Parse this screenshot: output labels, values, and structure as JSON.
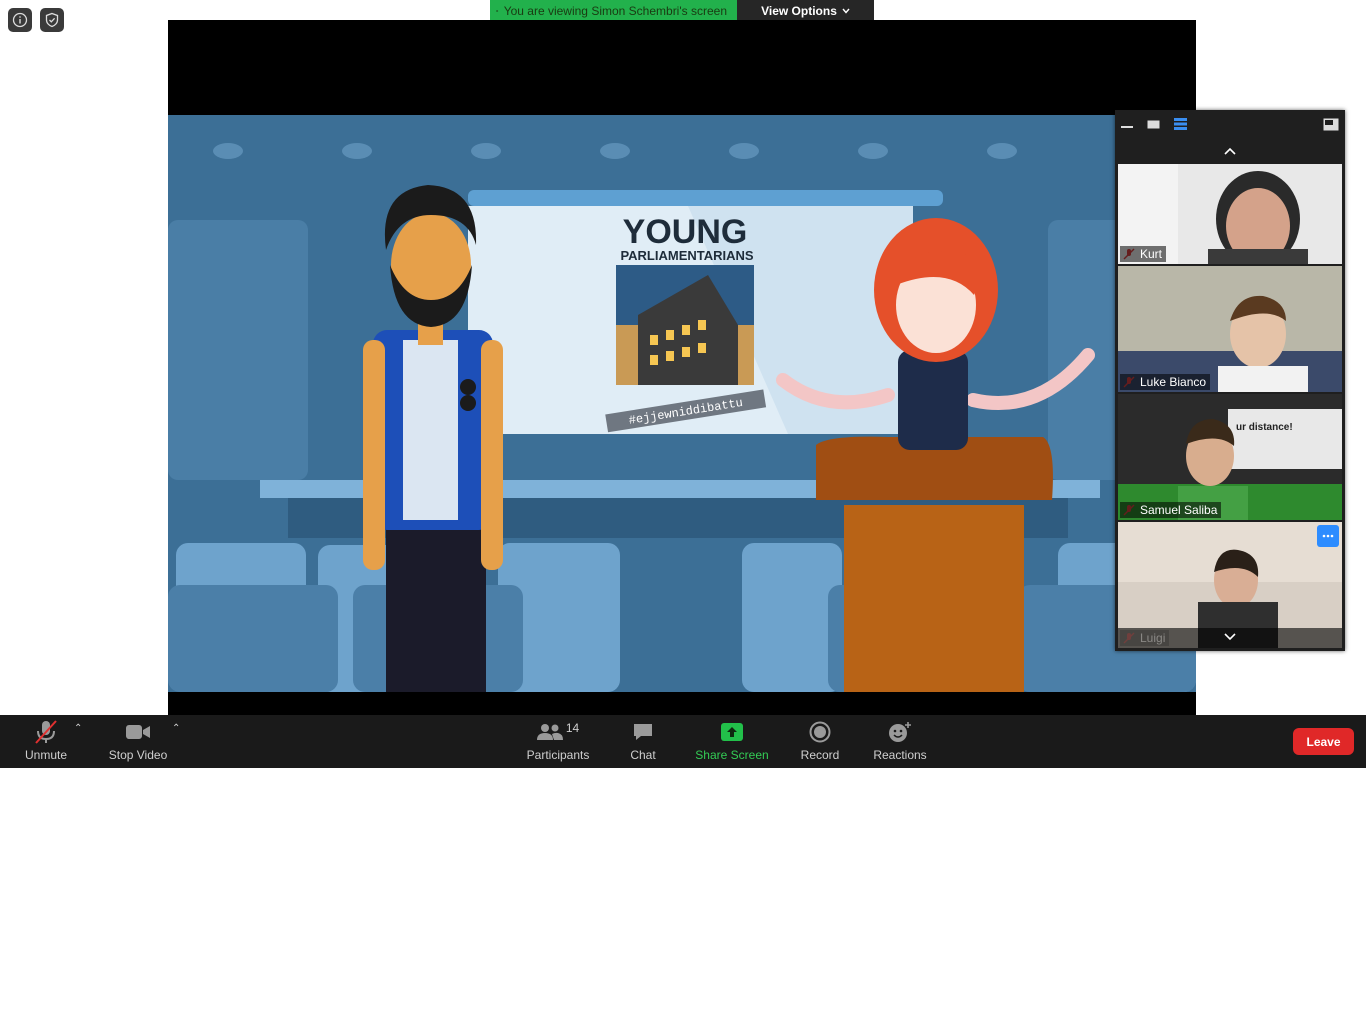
{
  "top_icons": {
    "info": "info-icon",
    "security": "shield-icon"
  },
  "banner": {
    "viewing_text": "You are viewing Simon Schembri's screen",
    "view_options_label": "View Options"
  },
  "shared_screen": {
    "poster_title": "YOUNG",
    "poster_subtitle": "PARLIAMENTARIANS",
    "hashtag": "#ejjewniddibattu",
    "poster_image_sign": "ur distance!"
  },
  "participants_panel": {
    "tiles": [
      {
        "name": "Kurt",
        "muted": true
      },
      {
        "name": "Luke Bianco",
        "muted": true
      },
      {
        "name": "Samuel Saliba",
        "muted": true
      },
      {
        "name": "Luigi",
        "muted": true
      }
    ]
  },
  "toolbar": {
    "unmute_label": "Unmute",
    "stop_video_label": "Stop Video",
    "participants_label": "Participants",
    "participants_count": "14",
    "chat_label": "Chat",
    "share_screen_label": "Share Screen",
    "record_label": "Record",
    "reactions_label": "Reactions",
    "leave_label": "Leave"
  },
  "colors": {
    "share_green": "#22b14c",
    "leave_red": "#e02828",
    "toolbar_bg": "#1a1a1a",
    "scene_blue": "#3c6f96"
  }
}
